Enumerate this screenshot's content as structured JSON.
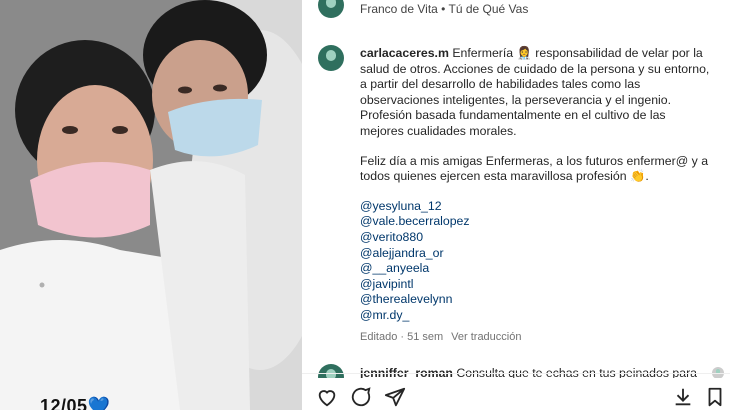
{
  "post": {
    "photo_caption": "12/05",
    "photo_emoji": "💙"
  },
  "audio": {
    "artist": "Franco de Vita",
    "separator": "•",
    "song": "Tú de Qué Vas"
  },
  "caption": {
    "username": "carlacaceres.m",
    "paragraph1": "Enfermería 👩‍⚕️ responsabilidad de velar por la salud de otros. Acciones de cuidado de la persona y su entorno, a partir del desarrollo de habilidades tales como las observaciones inteligentes, la perseverancia y el ingenio. Profesión basada fundamentalmente en el cultivo de las mejores cualidades morales.",
    "paragraph2": "Feliz día a mis amigas Enfermeras, a los futuros enfermer@ y a todos quienes ejercen esta maravillosa profesión 👏.",
    "mentions": [
      "@yesyluna_12",
      "@vale.becerralopez",
      "@verito880",
      "@alejjandra_or",
      "@__anyeela",
      "@javipintl",
      "@therealevelynn",
      "@mr.dy_"
    ]
  },
  "meta": {
    "edited": "Editado · 51 sem",
    "translate": "Ver traducción"
  },
  "comment": {
    "username": "jenniffer_roman",
    "text": "Consulta que te echas en tus peinados para"
  },
  "icons": {
    "like": "heart-icon",
    "comment": "comment-icon",
    "share": "send-icon",
    "save": "download-icon",
    "bookmark": "bookmark-icon"
  }
}
